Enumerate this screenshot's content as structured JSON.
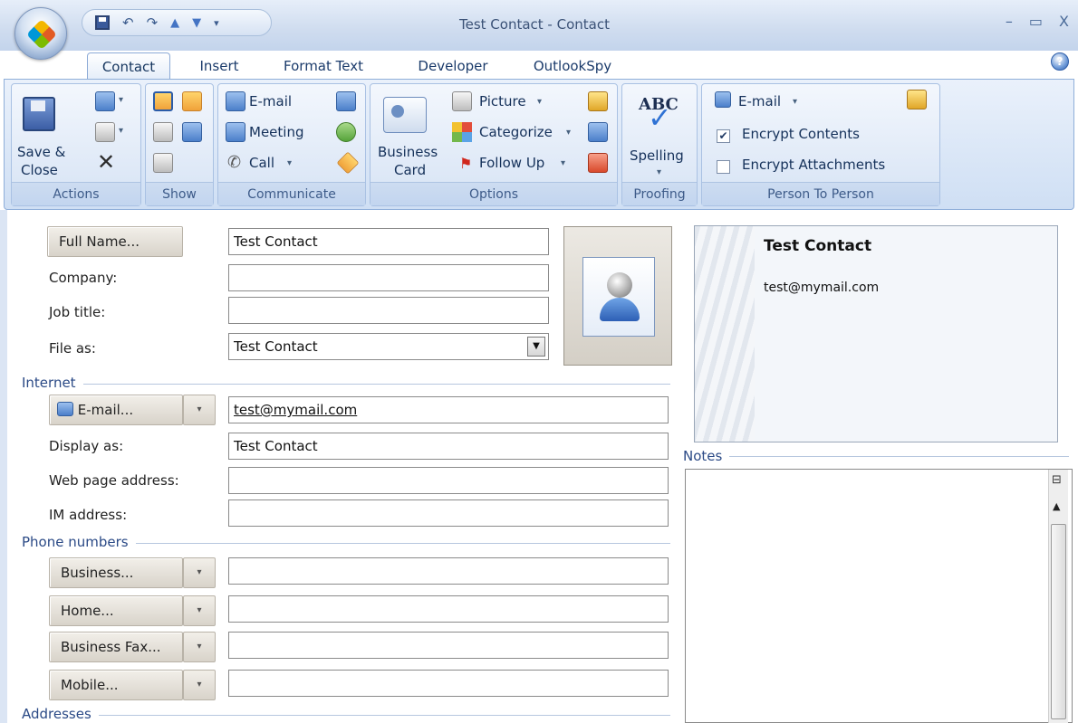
{
  "window": {
    "title": "Test Contact - Contact",
    "controls": [
      "–",
      "▭",
      "X"
    ]
  },
  "qat": {
    "icons": [
      "save-icon",
      "undo-icon",
      "redo-icon",
      "previous-item-icon",
      "next-item-icon",
      "customize-dropdown-icon"
    ]
  },
  "tabs": [
    "Contact",
    "Insert",
    "Format Text",
    "Developer",
    "OutlookSpy"
  ],
  "active_tab": "Contact",
  "ribbon": {
    "actions": {
      "label": "Actions",
      "save_close": "Save &",
      "save_close_2": "Close"
    },
    "show": {
      "label": "Show"
    },
    "communicate": {
      "label": "Communicate",
      "email": "E-mail",
      "meeting": "Meeting",
      "call": "Call"
    },
    "options": {
      "label": "Options",
      "business_card": "Business",
      "business_card_2": "Card",
      "picture": "Picture",
      "categorize": "Categorize",
      "follow_up": "Follow Up"
    },
    "proofing": {
      "label": "Proofing",
      "abc": "ABC",
      "spelling": "Spelling"
    },
    "person_to_person": {
      "label": "Person To Person",
      "email": "E-mail",
      "encrypt_contents": "Encrypt Contents",
      "encrypt_contents_checked": true,
      "encrypt_attachments": "Encrypt Attachments",
      "encrypt_attachments_checked": false
    }
  },
  "form": {
    "full_name_btn": "Full Name...",
    "full_name": "Test Contact",
    "company_lbl": "Company:",
    "company": "",
    "job_title_lbl": "Job title:",
    "job_title": "",
    "file_as_lbl": "File as:",
    "file_as": "Test Contact",
    "internet_lbl": "Internet",
    "email_btn": "E-mail...",
    "email": "test@mymail.com",
    "display_as_lbl": "Display as:",
    "display_as": "Test Contact",
    "web_page_lbl": "Web page address:",
    "web_page": "",
    "im_lbl": "IM address:",
    "im": "",
    "phone_lbl": "Phone numbers",
    "phones": [
      {
        "label": "Business...",
        "value": ""
      },
      {
        "label": "Home...",
        "value": ""
      },
      {
        "label": "Business Fax...",
        "value": ""
      },
      {
        "label": "Mobile...",
        "value": ""
      }
    ],
    "addresses_lbl": "Addresses"
  },
  "card": {
    "name": "Test Contact",
    "email": "test@mymail.com"
  },
  "notes": {
    "label": "Notes",
    "value": ""
  }
}
